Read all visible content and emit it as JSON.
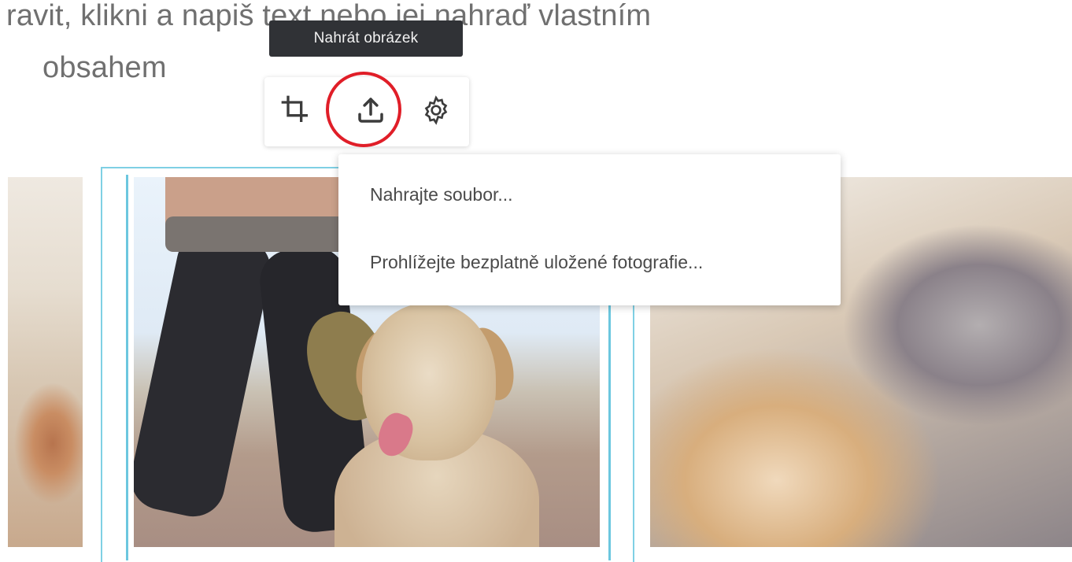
{
  "background_text": {
    "line1": "ravit, klikni a napiš text nebo jej nahraď vlastním",
    "line2": "obsahem"
  },
  "tooltip": {
    "text": "Nahrát obrázek"
  },
  "toolbar": {
    "tools": [
      {
        "icon": "crop-icon"
      },
      {
        "icon": "upload-icon"
      },
      {
        "icon": "gear-icon"
      }
    ],
    "highlight_color": "#e01e28"
  },
  "upload_menu": {
    "items": [
      {
        "label": "Nahrajte soubor..."
      },
      {
        "label": "Prohlížejte bezplatně uložené fotografie..."
      }
    ]
  },
  "colors": {
    "selection_border": "#7fd0e4",
    "tooltip_bg": "#303236"
  }
}
